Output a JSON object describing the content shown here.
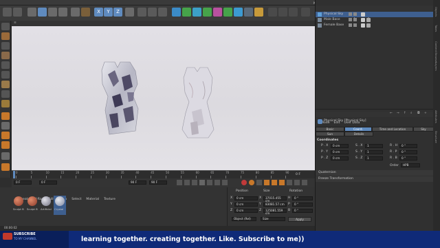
{
  "menu": [
    "File",
    "Edit",
    "Create",
    "Modes",
    "Select",
    "Tools",
    "Mesh",
    "Spline",
    "Volume",
    "MoGraph",
    "Character",
    "Animate",
    "Simulate",
    "Tracker",
    "Render",
    "Extensions",
    "V-Ray",
    "Window",
    "Help"
  ],
  "top_right": {
    "node_space_label": "Node Space:",
    "node_space_value": "Current (Standard/Physical)",
    "layout_label": "Layout:",
    "layout_value": "Startup"
  },
  "axis_lock": [
    "X",
    "Y",
    "Z"
  ],
  "viewport_menu": [
    "View",
    "Cameras",
    "Display",
    "Options",
    "Filter",
    "Panel"
  ],
  "objects_menu": [
    "File",
    "Edit",
    "View",
    "Object",
    "Tags",
    "Bookmarks"
  ],
  "objects": [
    {
      "name": "Physical Sky"
    },
    {
      "name": "Male Base"
    },
    {
      "name": "Female Base"
    }
  ],
  "attributes": {
    "menu": [
      "Mode",
      "Edit",
      "User Data"
    ],
    "title": "Physical Sky [Physical Sky]",
    "tabs_row1": [
      "Basic",
      "Coord.",
      "Time and Location",
      "Sky"
    ],
    "tabs_row2": [
      "Sun",
      "Details"
    ],
    "section": "Coordinates",
    "rows": [
      {
        "p": "P . X",
        "pv": "0 cm",
        "s": "S . X",
        "sv": "1",
        "r": "R . H",
        "rv": "0 °"
      },
      {
        "p": "P . Y",
        "pv": "0 cm",
        "s": "S . Y",
        "sv": "1",
        "r": "R . P",
        "rv": "0 °"
      },
      {
        "p": "P . Z",
        "pv": "0 cm",
        "s": "S . Z",
        "sv": "1",
        "r": "R . B",
        "rv": "0 °"
      }
    ],
    "order_label": "Order",
    "order_value": "HPB",
    "quaternion": "Quaternion",
    "freeze": "Freeze Transformation"
  },
  "side_tabs": [
    "Objects",
    "Takes",
    "Content Browser",
    "Layers",
    "Attributes",
    "Structure"
  ],
  "timeline_ticks": [
    "0",
    "5",
    "10",
    "15",
    "20",
    "25",
    "30",
    "35",
    "40",
    "45",
    "50",
    "55",
    "60",
    "65",
    "70",
    "75",
    "80",
    "85",
    "90"
  ],
  "timeline_end": "0 F",
  "transport": {
    "current": "0 F",
    "start": "0 F",
    "end": "90 F",
    "end2": "90 F"
  },
  "material_menu": [
    "Create",
    "V-Ray",
    "Edit",
    "View",
    "Select",
    "Material",
    "Texture"
  ],
  "materials": [
    "Sculpt B",
    "Sculpt B",
    "Artificial",
    "Crystal"
  ],
  "coords": {
    "headers": [
      "Position",
      "Size",
      "Rotation"
    ],
    "rows": [
      {
        "axis": "X",
        "pos": "0 cm",
        "size_axis": "X",
        "size": "37015.455 cm",
        "rot_axis": "H",
        "rot": "0 °"
      },
      {
        "axis": "Y",
        "pos": "0 cm",
        "size_axis": "Y",
        "size": "83081.57 cm",
        "rot_axis": "P",
        "rot": "0 °"
      },
      {
        "axis": "Z",
        "pos": "0 cm",
        "size_axis": "Z",
        "size": "125081.559 cm",
        "rot_axis": "B",
        "rot": "0 °"
      }
    ],
    "mode": "Object (Rel)",
    "size_mode": "Size",
    "apply": "Apply"
  },
  "status_time": "00:00:02",
  "banner": {
    "subscribe": "SUBSCRIBE",
    "sub2": "TO MY CHANNEL",
    "text": "learning together. creating together. Like. Subscribe to me))"
  },
  "colors": {
    "accent": "#5f8bbf",
    "banner": "#0f2a78",
    "selected": "#3e5f8f"
  }
}
